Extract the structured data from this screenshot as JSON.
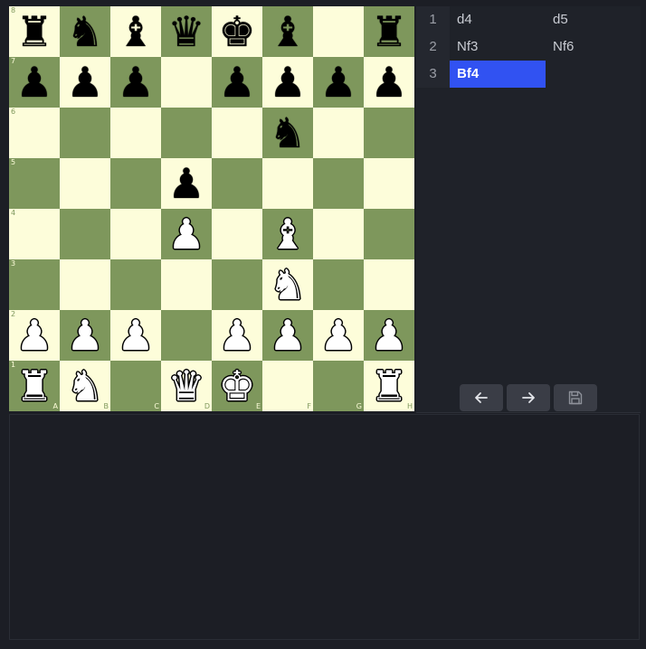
{
  "board": {
    "files": [
      "A",
      "B",
      "C",
      "D",
      "E",
      "F",
      "G",
      "H"
    ],
    "ranks": [
      "8",
      "7",
      "6",
      "5",
      "4",
      "3",
      "2",
      "1"
    ],
    "position": [
      [
        "bR",
        "bN",
        "bB",
        "bQ",
        "bK",
        "bB",
        "",
        "bR"
      ],
      [
        "bP",
        "bP",
        "bP",
        "",
        "bP",
        "bP",
        "bP",
        "bP"
      ],
      [
        "",
        "",
        "",
        "",
        "",
        "bN",
        "",
        ""
      ],
      [
        "",
        "",
        "",
        "bP",
        "",
        "",
        "",
        ""
      ],
      [
        "",
        "",
        "",
        "wP",
        "",
        "wB",
        "",
        ""
      ],
      [
        "",
        "",
        "",
        "",
        "",
        "wN",
        "",
        ""
      ],
      [
        "wP",
        "wP",
        "wP",
        "",
        "wP",
        "wP",
        "wP",
        "wP"
      ],
      [
        "wR",
        "wN",
        "",
        "wQ",
        "wK",
        "",
        "",
        "wR"
      ]
    ],
    "glyphs": {
      "K": "♚",
      "Q": "♛",
      "R": "♜",
      "B": "♝",
      "N": "♞",
      "P": "♟"
    },
    "colors": {
      "light": "#fdfdda",
      "dark": "#7e975c"
    }
  },
  "moves": [
    {
      "number": "1",
      "white": "d4",
      "black": "d5"
    },
    {
      "number": "2",
      "white": "Nf3",
      "black": "Nf6"
    },
    {
      "number": "3",
      "white": "Bf4",
      "black": ""
    }
  ],
  "active_move": {
    "row": 2,
    "side": "white"
  },
  "controls": {
    "prev_icon": "arrow-left-icon",
    "next_icon": "arrow-right-icon",
    "save_icon": "save-icon"
  },
  "accent": "#3152f2"
}
